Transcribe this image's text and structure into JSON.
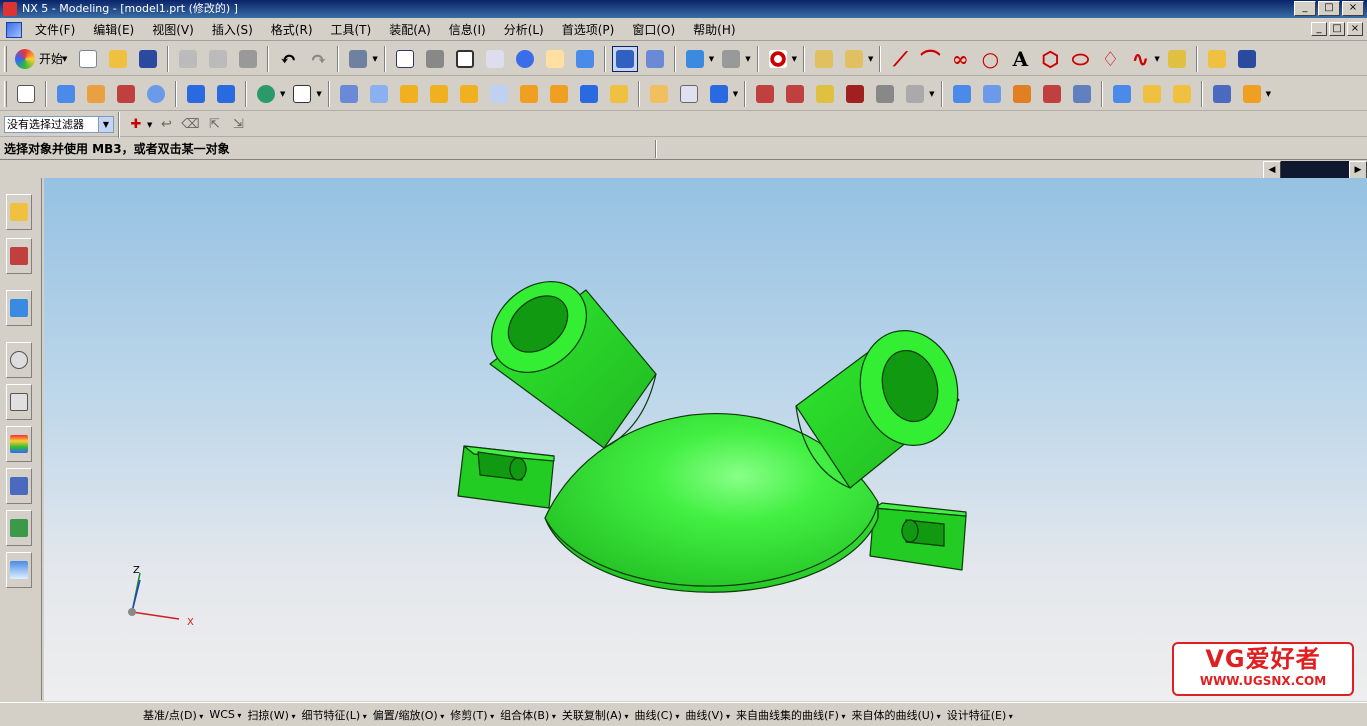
{
  "window": {
    "title": "NX 5 - Modeling - [model1.prt (修改的) ]",
    "buttons": [
      "_",
      "□",
      "×"
    ]
  },
  "menubar": {
    "items": [
      "文件(F)",
      "编辑(E)",
      "视图(V)",
      "插入(S)",
      "格式(R)",
      "工具(T)",
      "装配(A)",
      "信息(I)",
      "分析(L)",
      "首选项(P)",
      "窗口(O)",
      "帮助(H)"
    ]
  },
  "toolbar": {
    "start_label": "开始",
    "text_tool": "A"
  },
  "selection": {
    "filter_value": "没有选择过滤器"
  },
  "cue_line": "选择对象并使用 MB3，或者双击某一对象",
  "viewport": {
    "background_top": "#96c1e2",
    "background_bottom": "#eeeeee",
    "model_color": "#33ee33",
    "triad": {
      "z": "Z",
      "x": "X"
    }
  },
  "watermark": {
    "line1": "VG爱好者",
    "line2": "WWW.UGSNX.COM"
  },
  "bottom_toolbar": {
    "items": [
      "基准/点(D)",
      "WCS",
      "扫掠(W)",
      "细节特征(L)",
      "偏置/缩放(O)",
      "修剪(T)",
      "组合体(B)",
      "关联复制(A)",
      "曲线(C)",
      "曲线(V)",
      "来自曲线集的曲线(F)",
      "来自体的曲线(U)",
      "设计特征(E)"
    ]
  }
}
